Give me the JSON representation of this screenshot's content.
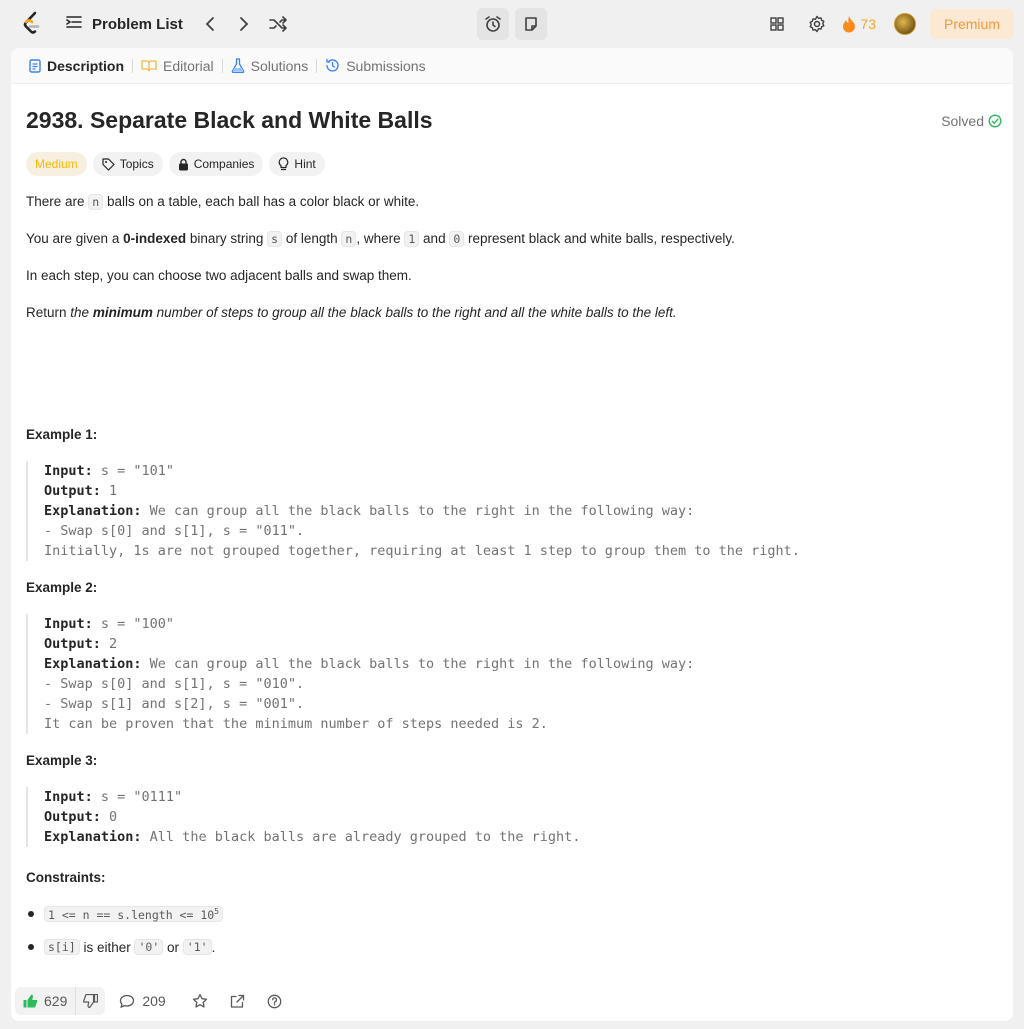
{
  "nav": {
    "problem_list": "Problem List",
    "streak_count": "73",
    "premium": "Premium"
  },
  "tabs": [
    {
      "label": "Description",
      "icon": "description-icon"
    },
    {
      "label": "Editorial",
      "icon": "book-icon"
    },
    {
      "label": "Solutions",
      "icon": "flask-icon"
    },
    {
      "label": "Submissions",
      "icon": "history-icon"
    }
  ],
  "problem": {
    "title": "2938. Separate Black and White Balls",
    "status": "Solved",
    "difficulty": "Medium",
    "chips": {
      "topics": "Topics",
      "companies": "Companies",
      "hint": "Hint"
    }
  },
  "description": {
    "p1": {
      "a": "There are ",
      "code": "n",
      "b": " balls on a table, each ball has a color black or white."
    },
    "p2": {
      "a": "You are given a ",
      "bold": "0-indexed",
      "b": " binary string ",
      "code1": "s",
      "c": " of length ",
      "code2": "n",
      "d": ", where ",
      "code3": "1",
      "e": " and ",
      "code4": "0",
      "f": " represent black and white balls, respectively."
    },
    "p3": "In each step, you can choose two adjacent balls and swap them.",
    "p4": {
      "a": "Return ",
      "b": "the ",
      "bold": "minimum",
      "c": " number of steps to group all the black balls to the right and all the white balls to the left."
    }
  },
  "examples": [
    {
      "heading": "Example 1:",
      "input_label": "Input:",
      "input": " s = \"101\"",
      "output_label": "Output:",
      "output": " 1",
      "explanation_label": "Explanation:",
      "explanation": " We can group all the black balls to the right in the following way:",
      "lines": [
        "- Swap s[0] and s[1], s = \"011\".",
        "Initially, 1s are not grouped together, requiring at least 1 step to group them to the right."
      ]
    },
    {
      "heading": "Example 2:",
      "input_label": "Input:",
      "input": " s = \"100\"",
      "output_label": "Output:",
      "output": " 2",
      "explanation_label": "Explanation:",
      "explanation": " We can group all the black balls to the right in the following way:",
      "lines": [
        "- Swap s[0] and s[1], s = \"010\".",
        "- Swap s[1] and s[2], s = \"001\".",
        "It can be proven that the minimum number of steps needed is 2."
      ]
    },
    {
      "heading": "Example 3:",
      "input_label": "Input:",
      "input": " s = \"0111\"",
      "output_label": "Output:",
      "output": " 0",
      "explanation_label": "Explanation:",
      "explanation": " All the black balls are already grouped to the right.",
      "lines": []
    }
  ],
  "constraints": {
    "heading": "Constraints:",
    "c1": {
      "code": "1 <= n == s.length <= 10",
      "sup": "5"
    },
    "c2": {
      "code1": "s[i]",
      "a": " is either ",
      "code2": "'0'",
      "b": " or ",
      "code3": "'1'",
      "c": "."
    }
  },
  "footer": {
    "likes": "629",
    "comments": "209"
  },
  "colors": {
    "accent": "#ffa116",
    "medium": "#ffb800",
    "solved": "#2cbb5d",
    "like": "#2cbb5d"
  }
}
